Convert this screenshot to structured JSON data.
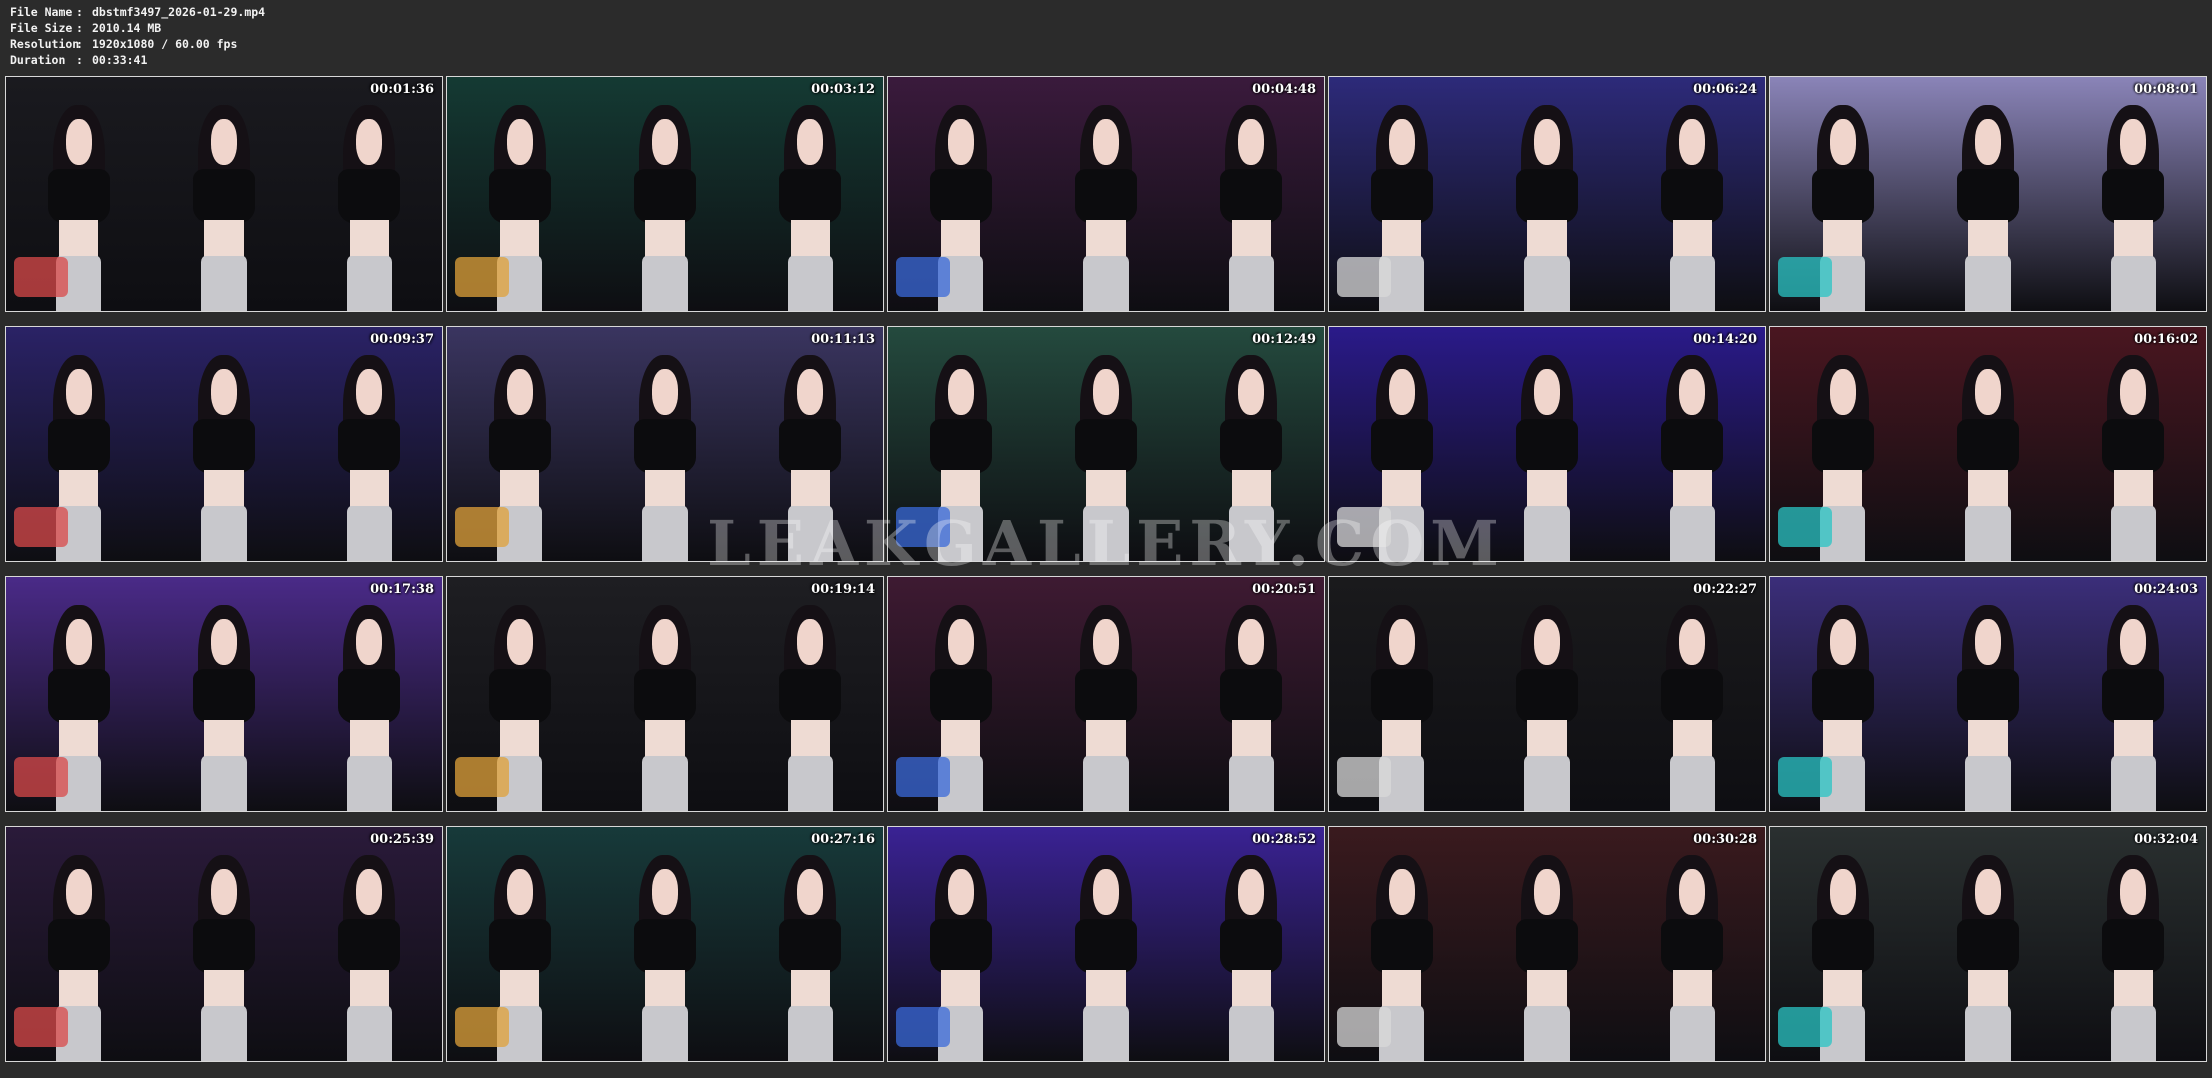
{
  "file_info": [
    {
      "label": "File Name",
      "value": "dbstmf3497_2026-01-29.mp4"
    },
    {
      "label": "File Size",
      "value": "2010.14 MB"
    },
    {
      "label": "Resolution",
      "value": "1920x1080 / 60.00 fps"
    },
    {
      "label": "Duration",
      "value": "00:33:41"
    }
  ],
  "separator": ":",
  "thumbnails": [
    {
      "timestamp": "00:01:36",
      "bg": "#1a1a1f"
    },
    {
      "timestamp": "00:03:12",
      "bg": "#143a33"
    },
    {
      "timestamp": "00:04:48",
      "bg": "#3a1a3c"
    },
    {
      "timestamp": "00:06:24",
      "bg": "#2d2a7a"
    },
    {
      "timestamp": "00:08:01",
      "bg": "#8a84b8"
    },
    {
      "timestamp": "00:09:37",
      "bg": "#2a2266"
    },
    {
      "timestamp": "00:11:13",
      "bg": "#3a3560"
    },
    {
      "timestamp": "00:12:49",
      "bg": "#244a3e"
    },
    {
      "timestamp": "00:14:20",
      "bg": "#2a1a8a"
    },
    {
      "timestamp": "00:16:02",
      "bg": "#4a1620"
    },
    {
      "timestamp": "00:17:38",
      "bg": "#4a2a88"
    },
    {
      "timestamp": "00:19:14",
      "bg": "#1e1e22"
    },
    {
      "timestamp": "00:20:51",
      "bg": "#3e1a32"
    },
    {
      "timestamp": "00:22:27",
      "bg": "#1a1a1c"
    },
    {
      "timestamp": "00:24:03",
      "bg": "#3b2e7a"
    },
    {
      "timestamp": "00:25:39",
      "bg": "#2a1a3a"
    },
    {
      "timestamp": "00:27:16",
      "bg": "#173a3a"
    },
    {
      "timestamp": "00:28:52",
      "bg": "#3a2294"
    },
    {
      "timestamp": "00:30:28",
      "bg": "#3a1a1e"
    },
    {
      "timestamp": "00:32:04",
      "bg": "#2a3030"
    }
  ],
  "watermark": "LEAKGALLERY.COM"
}
